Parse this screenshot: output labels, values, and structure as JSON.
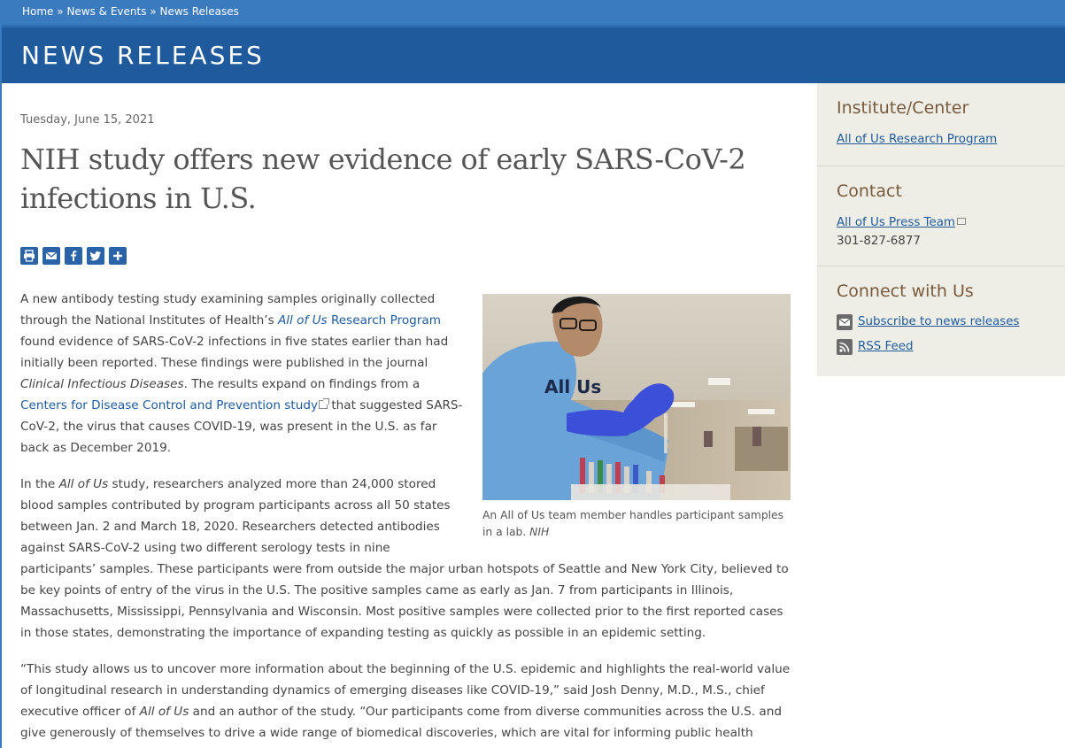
{
  "breadcrumb": {
    "items": [
      "Home",
      "News & Events",
      "News Releases"
    ],
    "separator": "»"
  },
  "banner": {
    "title": "NEWS RELEASES"
  },
  "article": {
    "date": "Tuesday, June 15, 2021",
    "headline": "NIH study offers new evidence of early SARS-CoV-2 infections in U.S.",
    "share_icons": [
      "print-icon",
      "email-icon",
      "facebook-icon",
      "twitter-icon",
      "plus-icon"
    ],
    "p1": {
      "t1": "A new antibody testing study examining samples originally collected through the National Institutes of Health’s ",
      "link1_em": "All of Us",
      "link1_rest": " Research Program",
      "t2": " found evidence of SARS-CoV-2 infections in five states earlier than had initially been reported. These findings were published in the journal ",
      "journal": "Clinical Infectious Diseases",
      "t3": ". The results expand on findings from a ",
      "link2": "Centers for Disease Control and Prevention study",
      "t4": " that suggested SARS-CoV-2, the virus that causes COVID-19, was present in the U.S. as far back as December 2019."
    },
    "p2": {
      "t1": "In the ",
      "em1": "All of Us",
      "t2": " study, researchers analyzed more than 24,000 stored blood samples contributed by program participants across all 50 states between Jan. 2 and March 18, 2020. Researchers detected antibodies against SARS-CoV-2 using two different serology tests in nine participants’ samples. These participants were from outside the major urban hotspots of Seattle and New York City, believed to be key points of entry of the virus in the U.S. The positive samples came as early as Jan. 7 from participants in Illinois, Massachusetts, Mississippi, Pennsylvania and Wisconsin. Most positive samples were collected prior to the first reported cases in those states, demonstrating the importance of expanding testing as quickly as possible in an epidemic setting."
    },
    "p3": {
      "t1": "“This study allows us to uncover more information about the beginning of the U.S. epidemic and highlights the real-world value of longitudinal research in understanding dynamics of emerging diseases like COVID-19,” said Josh Denny, M.D., M.S., chief executive officer of ",
      "em1": "All of Us",
      "t2": " and an author of the study. “Our participants come from diverse communities across the U.S. and give generously of themselves to drive a wide range of biomedical discoveries, which are vital for informing public health strategies and preparedness.”"
    },
    "figure": {
      "shirt_text": "All Us",
      "caption": "An All of Us team member handles participant samples in a lab.",
      "credit": "NIH"
    }
  },
  "sidebar": {
    "institute": {
      "title": "Institute/Center",
      "link": "All of Us Research Program"
    },
    "contact": {
      "title": "Contact",
      "link": "All of Us Press Team",
      "phone": "301-827-6877"
    },
    "connect": {
      "title": "Connect with Us",
      "items": [
        {
          "label": "Subscribe to news releases",
          "icon": "envelope-icon"
        },
        {
          "label": "RSS Feed",
          "icon": "rss-icon"
        }
      ]
    }
  },
  "colors": {
    "topbar": "#3a7bbf",
    "banner": "#1f5a9d",
    "link": "#1f5a9d",
    "sidebar_bg": "#eeeee6",
    "sidebar_heading": "#7a5a3c"
  }
}
